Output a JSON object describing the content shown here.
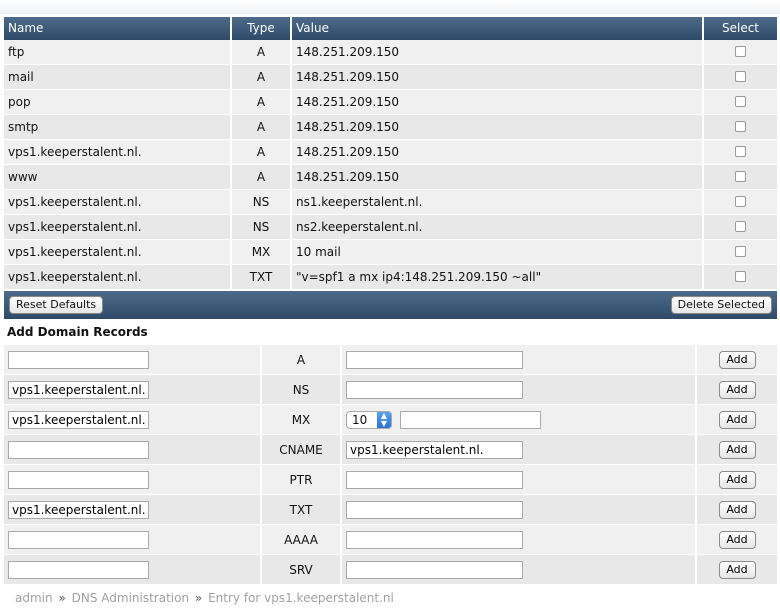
{
  "records_table": {
    "headers": {
      "name": "Name",
      "type": "Type",
      "value": "Value",
      "select": "Select"
    },
    "rows": [
      {
        "name": "ftp",
        "type": "A",
        "value": "148.251.209.150"
      },
      {
        "name": "mail",
        "type": "A",
        "value": "148.251.209.150"
      },
      {
        "name": "pop",
        "type": "A",
        "value": "148.251.209.150"
      },
      {
        "name": "smtp",
        "type": "A",
        "value": "148.251.209.150"
      },
      {
        "name": "vps1.keeperstalent.nl.",
        "type": "A",
        "value": "148.251.209.150"
      },
      {
        "name": "www",
        "type": "A",
        "value": "148.251.209.150"
      },
      {
        "name": "vps1.keeperstalent.nl.",
        "type": "NS",
        "value": "ns1.keeperstalent.nl."
      },
      {
        "name": "vps1.keeperstalent.nl.",
        "type": "NS",
        "value": "ns2.keeperstalent.nl."
      },
      {
        "name": "vps1.keeperstalent.nl.",
        "type": "MX",
        "value": "10 mail"
      },
      {
        "name": "vps1.keeperstalent.nl.",
        "type": "TXT",
        "value": "\"v=spf1 a mx ip4:148.251.209.150 ~all\""
      }
    ]
  },
  "actions": {
    "reset_label": "Reset Defaults",
    "delete_label": "Delete Selected"
  },
  "add_section": {
    "title": "Add Domain Records",
    "add_label": "Add",
    "rows": [
      {
        "type": "A",
        "name_value": "",
        "value": ""
      },
      {
        "type": "NS",
        "name_value": "vps1.keeperstalent.nl.",
        "value": ""
      },
      {
        "type": "MX",
        "name_value": "vps1.keeperstalent.nl.",
        "priority": "10",
        "value": ""
      },
      {
        "type": "CNAME",
        "name_value": "",
        "value": "vps1.keeperstalent.nl."
      },
      {
        "type": "PTR",
        "name_value": "",
        "value": ""
      },
      {
        "type": "TXT",
        "name_value": "vps1.keeperstalent.nl.",
        "value": ""
      },
      {
        "type": "AAAA",
        "name_value": "",
        "value": ""
      },
      {
        "type": "SRV",
        "name_value": "",
        "value": ""
      }
    ]
  },
  "breadcrumb": {
    "items": [
      "admin",
      "DNS Administration",
      "Entry for vps1.keeperstalent.nl"
    ],
    "separator": "»"
  },
  "colors": {
    "header_bar": "#3d5b7a",
    "row_light": "#f0f0f0",
    "row_dark": "#e8e8e8"
  }
}
